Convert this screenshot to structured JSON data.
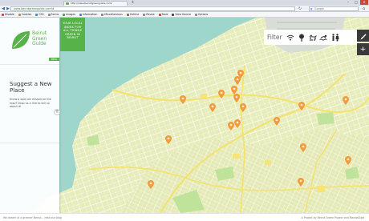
{
  "browser": {
    "tab_title": "http://www.beirutgreenguide.com/",
    "url": "www.beirutgreenguide.com/#",
    "search_engine": "Google",
    "bookmarks": [
      {
        "label": "Disable",
        "color": "#c44"
      },
      {
        "label": "Cookies",
        "color": "#b84"
      },
      {
        "label": "CSS",
        "color": "#48c"
      },
      {
        "label": "Forms",
        "color": "#888"
      },
      {
        "label": "Images",
        "color": "#4a4"
      },
      {
        "label": "Information",
        "color": "#48c"
      },
      {
        "label": "Miscellaneous",
        "color": "#888"
      },
      {
        "label": "Outline",
        "color": "#a64"
      },
      {
        "label": "Resize",
        "color": "#888"
      },
      {
        "label": "Tools",
        "color": "#c44"
      },
      {
        "label": "View Source",
        "color": "#444"
      },
      {
        "label": "Options",
        "color": "#888"
      }
    ]
  },
  "site": {
    "brand_line1": "Beirut",
    "brand_line2": "Green",
    "brand_line3": "Guide",
    "beta": "BETA",
    "tagline": "YOUR LOCAL INDEX FOR ALL THINGS GREEN IN BEIRUT",
    "suggest_title": "Suggest a New Place",
    "suggest_text": "Know a spot we missed on the map? Drop us a line to tell us about it!",
    "filter_label": "Filter",
    "footer_left": "We dream of a greener Beirut... read our blog",
    "footer_right": "A Project by Beirut Green Project and MandaDigit"
  },
  "colors": {
    "green": "#58b24a",
    "pin": "#f39a3a",
    "water": "#9fd6cc",
    "land": "#e5eab7"
  },
  "map_pins": [
    "pin-1",
    "pin-2",
    "pin-3",
    "pin-4",
    "pin-5",
    "pin-6",
    "pin-7",
    "pin-8",
    "pin-9",
    "pin-10",
    "pin-11",
    "pin-12",
    "pin-13",
    "pin-14",
    "pin-15",
    "pin-16",
    "pin-17",
    "pin-18"
  ]
}
